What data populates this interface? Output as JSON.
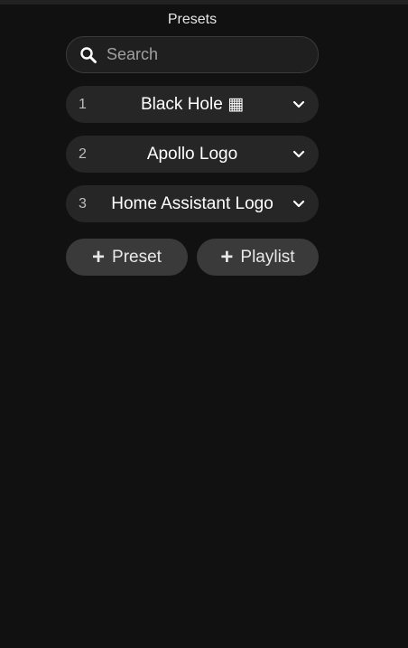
{
  "panel": {
    "title": "Presets"
  },
  "search": {
    "placeholder": "Search",
    "value": ""
  },
  "presets": [
    {
      "number": "1",
      "name": "Black Hole ▦"
    },
    {
      "number": "2",
      "name": "Apollo Logo"
    },
    {
      "number": "3",
      "name": "Home Assistant Logo"
    }
  ],
  "actions": {
    "add_preset_label": "Preset",
    "add_playlist_label": "Playlist"
  },
  "icons": {
    "search": "search-icon",
    "chevron": "chevron-down-icon",
    "plus": "plus-icon"
  },
  "colors": {
    "background": "#111111",
    "item_background": "#262626",
    "button_background": "#3a3a3a"
  }
}
